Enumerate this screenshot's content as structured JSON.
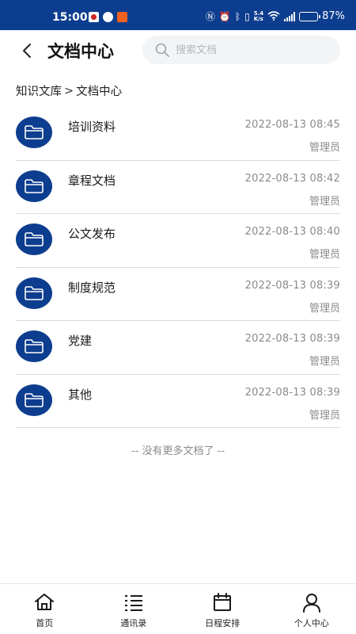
{
  "status_bar": {
    "time": "15:00",
    "network_speed_top": "5.4",
    "network_speed_bottom": "K/s",
    "battery_text": "87%",
    "battery_level": 0.87
  },
  "header": {
    "title": "文档中心",
    "search_placeholder": "搜索文档"
  },
  "breadcrumb": {
    "root": "知识文库",
    "separator": ">",
    "current": "文档中心"
  },
  "folders": [
    {
      "name": "培训资料",
      "time": "2022-08-13 08:45",
      "owner": "管理员"
    },
    {
      "name": "章程文档",
      "time": "2022-08-13 08:42",
      "owner": "管理员"
    },
    {
      "name": "公文发布",
      "time": "2022-08-13 08:40",
      "owner": "管理员"
    },
    {
      "name": "制度规范",
      "time": "2022-08-13 08:39",
      "owner": "管理员"
    },
    {
      "name": "党建",
      "time": "2022-08-13 08:39",
      "owner": "管理员"
    },
    {
      "name": "其他",
      "time": "2022-08-13 08:39",
      "owner": "管理员"
    }
  ],
  "list_footer": "-- 没有更多文档了 --",
  "bottom_nav": [
    {
      "label": "首页",
      "icon": "home-icon"
    },
    {
      "label": "通讯录",
      "icon": "list-icon"
    },
    {
      "label": "日程安排",
      "icon": "calendar-icon"
    },
    {
      "label": "个人中心",
      "icon": "user-icon"
    }
  ],
  "colors": {
    "brand": "#0d3d8e",
    "muted_text": "#8a8a8a",
    "divider": "#dcdcdc"
  }
}
